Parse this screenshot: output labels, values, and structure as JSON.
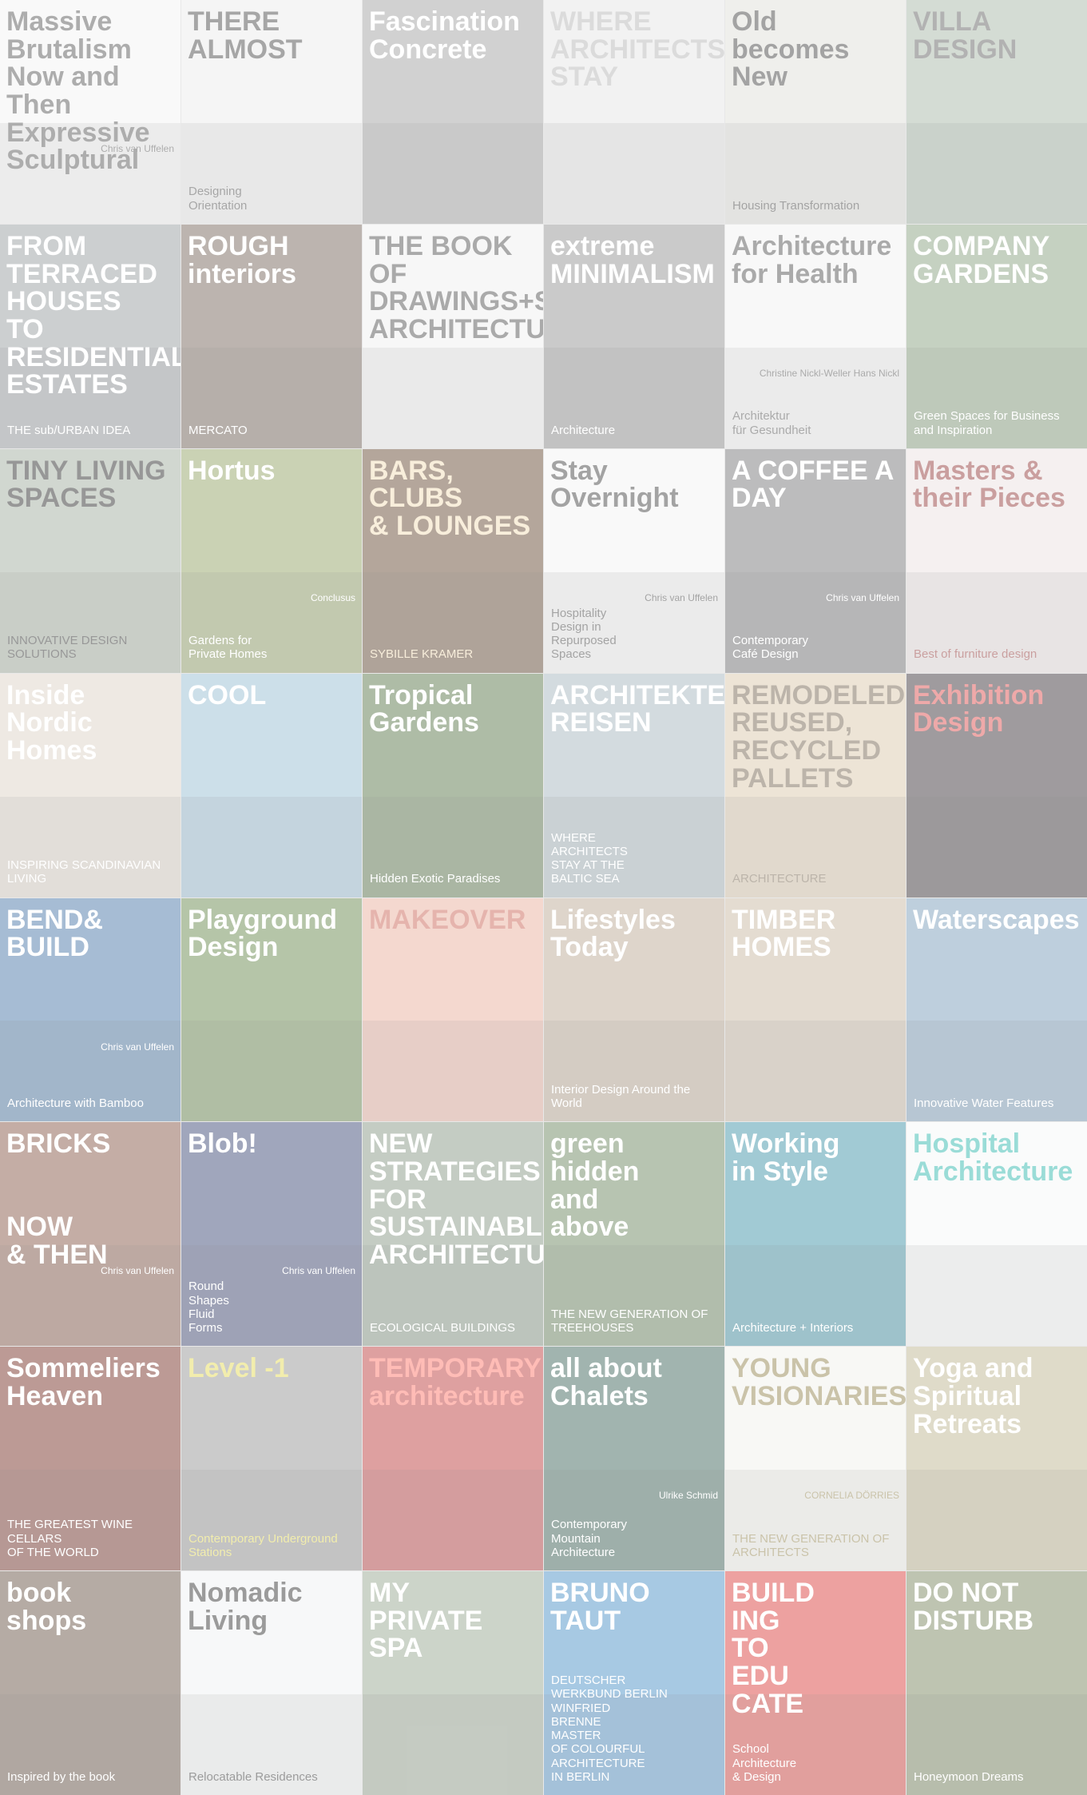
{
  "covers": [
    {
      "title": "Massive\nBrutalism\nNow and Then\nExpressive\nSculptural",
      "subtitle": "",
      "author": "Chris van Uffelen",
      "bg": "#f2f2f2",
      "fg": "#4a4a4a"
    },
    {
      "title": "THERE\nALMOST",
      "subtitle": "Designing\nOrientation",
      "author": "",
      "bg": "#e9e9e9",
      "fg": "#3a3a3a"
    },
    {
      "title": "Fascination\nConcrete",
      "subtitle": "",
      "author": "",
      "bg": "#9a9a9a",
      "fg": "#ffffff"
    },
    {
      "title": "WHERE\nARCHITECTS\nSTAY",
      "subtitle": "",
      "author": "",
      "bg": "#e2e2e2",
      "fg": "#b0b0b0"
    },
    {
      "title": "Old becomes New",
      "subtitle": "Housing Transformation",
      "author": "",
      "bg": "#dcdcd6",
      "fg": "#333333"
    },
    {
      "title": "VILLA\nDESIGN",
      "subtitle": "",
      "author": "",
      "bg": "#9fb1a0",
      "fg": "#555555"
    },
    {
      "title": "FROM\nTERRACED\nHOUSES\nTO\nRESIDENTIAL\nESTATES",
      "subtitle": "THE sub/URBAN IDEA",
      "author": "",
      "bg": "#8f9498",
      "fg": "#ffffff"
    },
    {
      "title": "ROUGH\ninteriors",
      "subtitle": "MERCATO",
      "author": "",
      "bg": "#6a5a4e",
      "fg": "#ffffff"
    },
    {
      "title": "THE BOOK OF\nDRAWINGS+SKETCHES\nARCHITECTURE",
      "subtitle": "",
      "author": "",
      "bg": "#eeeeee",
      "fg": "#444444"
    },
    {
      "title": "extreme\nMINIMALISM",
      "subtitle": "Architecture",
      "author": "",
      "bg": "#8a8a8a",
      "fg": "#ffffff"
    },
    {
      "title": "Architecture\nfor Health",
      "subtitle": "Architektur\nfür Gesundheit",
      "author": "Christine Nickl-Weller\nHans Nickl",
      "bg": "#f0f0f0",
      "fg": "#444444"
    },
    {
      "title": "COMPANY GARDENS",
      "subtitle": "Green Spaces for Business and Inspiration",
      "author": "",
      "bg": "#7f9a76",
      "fg": "#ffffff"
    },
    {
      "title": "TINY LIVING SPACES",
      "subtitle": "INNOVATIVE DESIGN SOLUTIONS",
      "author": "",
      "bg": "#9aa797",
      "fg": "#1a1a1a"
    },
    {
      "title": "Hortus",
      "subtitle": "Gardens for\nPrivate Homes",
      "author": "Conclusus",
      "bg": "#8a9b5a",
      "fg": "#ffffff"
    },
    {
      "title": "BARS, CLUBS\n& LOUNGES",
      "subtitle": "SYBILLE KRAMER",
      "author": "",
      "bg": "#5a3b22",
      "fg": "#f0d9b0"
    },
    {
      "title": "Stay\nOvernight",
      "subtitle": "Hospitality\nDesign in\nRepurposed\nSpaces",
      "author": "Chris van Uffelen",
      "bg": "#f1f1f1",
      "fg": "#333333"
    },
    {
      "title": "A COFFEE A DAY",
      "subtitle": "Contemporary\nCafé Design",
      "author": "Chris van Uffelen",
      "bg": "#6b6b6e",
      "fg": "#ffffff"
    },
    {
      "title": "Masters & their Pieces",
      "subtitle": "Best of furniture design",
      "author": "",
      "bg": "#e9dede",
      "fg": "#8a2b2b"
    },
    {
      "title": "Inside\nNordic Homes",
      "subtitle": "INSPIRING SCANDINAVIAN LIVING",
      "author": "",
      "bg": "#d9cfc2",
      "fg": "#ffffff"
    },
    {
      "title": "COOL",
      "subtitle": "",
      "author": "",
      "bg": "#8fb8cf",
      "fg": "#ffffff"
    },
    {
      "title": "Tropical\nGardens",
      "subtitle": "Hidden Exotic Paradises",
      "author": "",
      "bg": "#4d6b3b",
      "fg": "#ffffff"
    },
    {
      "title": "ARCHITEKTEN\nREISEN",
      "subtitle": "WHERE\nARCHITECTS\nSTAY AT THE\nBALTIC SEA",
      "author": "",
      "bg": "#9db0b8",
      "fg": "#ffffff"
    },
    {
      "title": "REMODELED, REUSED, RECYCLED\nPALLETS",
      "subtitle": "ARCHITECTURE",
      "author": "",
      "bg": "#d7c3a4",
      "fg": "#6a5a44"
    },
    {
      "title": "Exhibition\nDesign",
      "subtitle": "",
      "author": "",
      "bg": "#2b2228",
      "fg": "#d94040"
    },
    {
      "title": "BEND&\nBUILD",
      "subtitle": "Architecture with Bamboo",
      "author": "Chris van Uffelen",
      "bg": "#3a6a9f",
      "fg": "#ffffff"
    },
    {
      "title": "Playground\nDesign",
      "subtitle": "",
      "author": "",
      "bg": "#5c7f3e",
      "fg": "#ffffff"
    },
    {
      "title": "MAKEOVER",
      "subtitle": "",
      "author": "",
      "bg": "#e6a896",
      "fg": "#c55a4a"
    },
    {
      "title": "Lifestyles Today",
      "subtitle": "Interior Design Around the World",
      "author": "",
      "bg": "#b7a38c",
      "fg": "#ffffff"
    },
    {
      "title": "TIMBER HOMES",
      "subtitle": "",
      "author": "",
      "bg": "#c4b19a",
      "fg": "#ffffff"
    },
    {
      "title": "Waterscapes",
      "subtitle": "Innovative Water Features",
      "author": "",
      "bg": "#6f95b3",
      "fg": "#ffffff"
    },
    {
      "title": "BRICKS\n\n\nNOW\n& THEN",
      "subtitle": "",
      "author": "Chris van Uffelen",
      "bg": "#7d4a38",
      "fg": "#ffffff"
    },
    {
      "title": "Blob!",
      "subtitle": "Round\nShapes\nFluid\nForms",
      "author": "Chris van Uffelen",
      "bg": "#2e3a6b",
      "fg": "#ffffff"
    },
    {
      "title": "NEW\nSTRATEGIES\nFOR\nSUSTAINABLE\nARCHITECTURE",
      "subtitle": "ECOLOGICAL BUILDINGS",
      "author": "",
      "bg": "#7c8f7a",
      "fg": "#ffffff"
    },
    {
      "title": "green\nhidden\nand\nabove",
      "subtitle": "THE NEW GENERATION OF TREEHOUSES",
      "author": "",
      "bg": "#5f7d52",
      "fg": "#ffffff"
    },
    {
      "title": "Working\nin Style",
      "subtitle": "Architecture + Interiors",
      "author": "",
      "bg": "#2f8aa0",
      "fg": "#ffffff"
    },
    {
      "title": "Hospital\nArchitecture",
      "subtitle": "",
      "author": "",
      "bg": "#f3f6f6",
      "fg": "#1fb1a6"
    },
    {
      "title": "Sommeliers\nHeaven",
      "subtitle": "THE GREATEST WINE CELLARS\nOF THE WORLD",
      "author": "",
      "bg": "#6b1f16",
      "fg": "#ffffff"
    },
    {
      "title": "Level -1",
      "subtitle": "Contemporary Underground Stations",
      "author": "",
      "bg": "#8d8d8d",
      "fg": "#e2d84a"
    },
    {
      "title": "TEMPORARY\narchitecture",
      "subtitle": "",
      "author": "",
      "bg": "#b72d2e",
      "fg": "#ff6b5e"
    },
    {
      "title": "all about\nChalets",
      "subtitle": "Contemporary\nMountain\nArchitecture",
      "author": "Ulrike Schmid",
      "bg": "#2f5a4e",
      "fg": "#ffffff"
    },
    {
      "title": "YOUNG\nVISIONARIES",
      "subtitle": "THE NEW GENERATION OF ARCHITECTS",
      "author": "CORNELIA DÖRRIES",
      "bg": "#f0efe9",
      "fg": "#8a7a40"
    },
    {
      "title": "Yoga and\nSpiritual Retreats",
      "subtitle": "",
      "author": "",
      "bg": "#b9b088",
      "fg": "#ffffff"
    },
    {
      "title": "book\nshops",
      "subtitle": "Inspired by the book",
      "author": "",
      "bg": "#5c4636",
      "fg": "#ffffff"
    },
    {
      "title": "Nomadic Living",
      "subtitle": "Relocatable Residences",
      "author": "",
      "bg": "#eef0f1",
      "fg": "#222222"
    },
    {
      "title": "MY\nPRIVATE\nSPA",
      "subtitle": "",
      "author": "",
      "bg": "#8f9f88",
      "fg": "#ffffff"
    },
    {
      "title": "BRUNO TAUT",
      "subtitle": "DEUTSCHER\nWERKBUND BERLIN\nWINFRIED\nBRENNE\nMASTER\nOF COLOURFUL\nARCHITECTURE\nIN BERLIN",
      "author": "",
      "bg": "#3d87c2",
      "fg": "#ffffff"
    },
    {
      "title": "BUILD\nING\nTO\nEDU\nCATE",
      "subtitle": "School\nArchitecture\n& Design",
      "author": "",
      "bg": "#d7302d",
      "fg": "#ffffff"
    },
    {
      "title": "DO NOT DISTURB",
      "subtitle": "Honeymoon Dreams",
      "author": "",
      "bg": "#6f7d52",
      "fg": "#ffffff"
    }
  ]
}
